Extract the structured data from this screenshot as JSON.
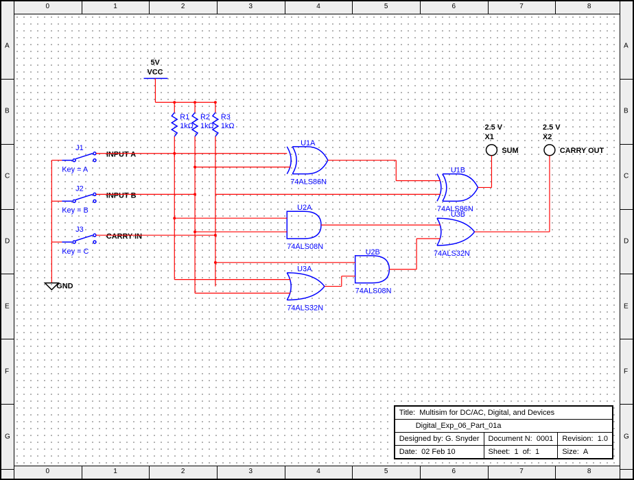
{
  "ruler_h_labels": [
    "0",
    "1",
    "2",
    "3",
    "4",
    "5",
    "6",
    "7",
    "8"
  ],
  "ruler_v_labels": [
    "A",
    "B",
    "C",
    "D",
    "E",
    "F",
    "G"
  ],
  "power": {
    "vcc_voltage": "5V",
    "vcc_label": "VCC",
    "gnd_label": "GND"
  },
  "resistors": [
    {
      "ref": "R1",
      "val": "1kΩ"
    },
    {
      "ref": "R2",
      "val": "1kΩ"
    },
    {
      "ref": "R3",
      "val": "1kΩ"
    }
  ],
  "switches": [
    {
      "ref": "J1",
      "key": "Key = A",
      "label": "INPUT A"
    },
    {
      "ref": "J2",
      "key": "Key = B",
      "label": "INPUT B"
    },
    {
      "ref": "J3",
      "key": "Key = C",
      "label": "CARRY IN"
    }
  ],
  "gates": [
    {
      "ref": "U1A",
      "part": "74ALS86N"
    },
    {
      "ref": "U1B",
      "part": "74ALS86N"
    },
    {
      "ref": "U2A",
      "part": "74ALS08N"
    },
    {
      "ref": "U2B",
      "part": "74ALS08N"
    },
    {
      "ref": "U3A",
      "part": "74ALS32N"
    },
    {
      "ref": "U3B",
      "part": "74ALS32N"
    }
  ],
  "probes": [
    {
      "voltage": "2.5 V",
      "ref": "X1",
      "name": "SUM"
    },
    {
      "voltage": "2.5 V",
      "ref": "X2",
      "name": "CARRY OUT"
    }
  ],
  "titleblock": {
    "title_label": "Title:",
    "title": "Multisim for DC/AC, Digital, and Devices",
    "subtitle": "Digital_Exp_06_Part_01a",
    "designed_label": "Designed by:",
    "designed": "G. Snyder",
    "docnum_label": "Document N:",
    "docnum": "0001",
    "revision_label": "Revision:",
    "revision": "1.0",
    "date_label": "Date:",
    "date": "02 Feb 10",
    "sheet_label": "Sheet:",
    "sheet_n": "1",
    "sheet_of": "of:",
    "sheet_total": "1",
    "size_label": "Size:",
    "size": "A"
  }
}
